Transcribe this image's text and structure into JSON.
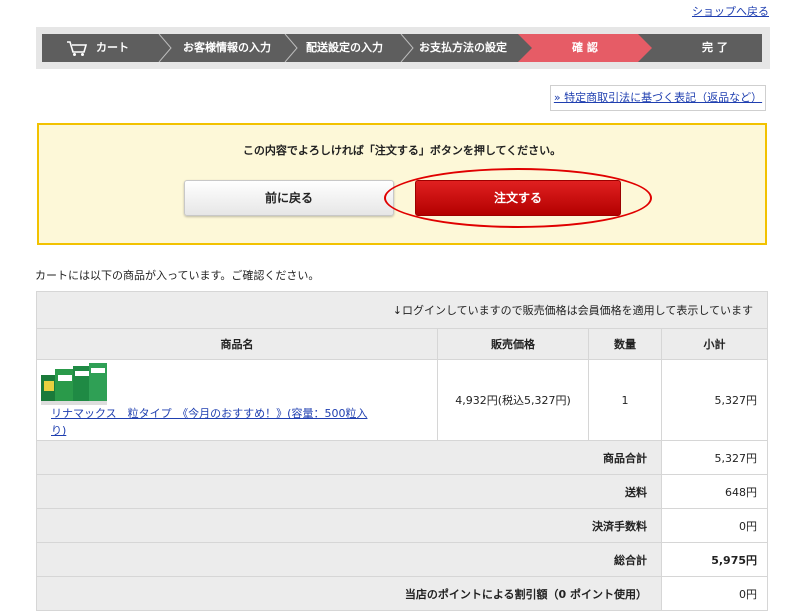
{
  "header": {
    "shop_back": "ショップへ戻る"
  },
  "steps": [
    "カート",
    "お客様情報の入力",
    "配送設定の入力",
    "お支払方法の設定",
    "確 認",
    "完 了"
  ],
  "law_link": "» 特定商取引法に基づく表記（返品など）",
  "confirm": {
    "message": "この内容でよろしければ「注文する」ボタンを押してください。",
    "back_button": "前に戻る",
    "order_button": "注文する"
  },
  "cart_note": "カートには以下の商品が入っています。ご確認ください。",
  "table": {
    "notice": "↓ログインしていますので販売価格は会員価格を適用して表示しています",
    "headers": {
      "name": "商品名",
      "price": "販売価格",
      "qty": "数量",
      "subtotal": "小計"
    },
    "item": {
      "name": "リナマックス　粒タイプ　《今月のおすすめ！》(容量：500粒入り)",
      "price": "4,932円(税込5,327円)",
      "qty": "1",
      "subtotal": "5,327円"
    },
    "summary": [
      {
        "label": "商品合計",
        "value": "5,327円"
      },
      {
        "label": "送料",
        "value": "648円"
      },
      {
        "label": "決済手数料",
        "value": "0円"
      },
      {
        "label": "総合計",
        "value": "5,975円"
      },
      {
        "label": "当店のポイントによる割引額（0 ポイント使用）",
        "value": "0円"
      }
    ]
  },
  "colors": {
    "active_step": "#e65c66",
    "order_button": "#c80000",
    "confirm_border": "#f2c200"
  }
}
